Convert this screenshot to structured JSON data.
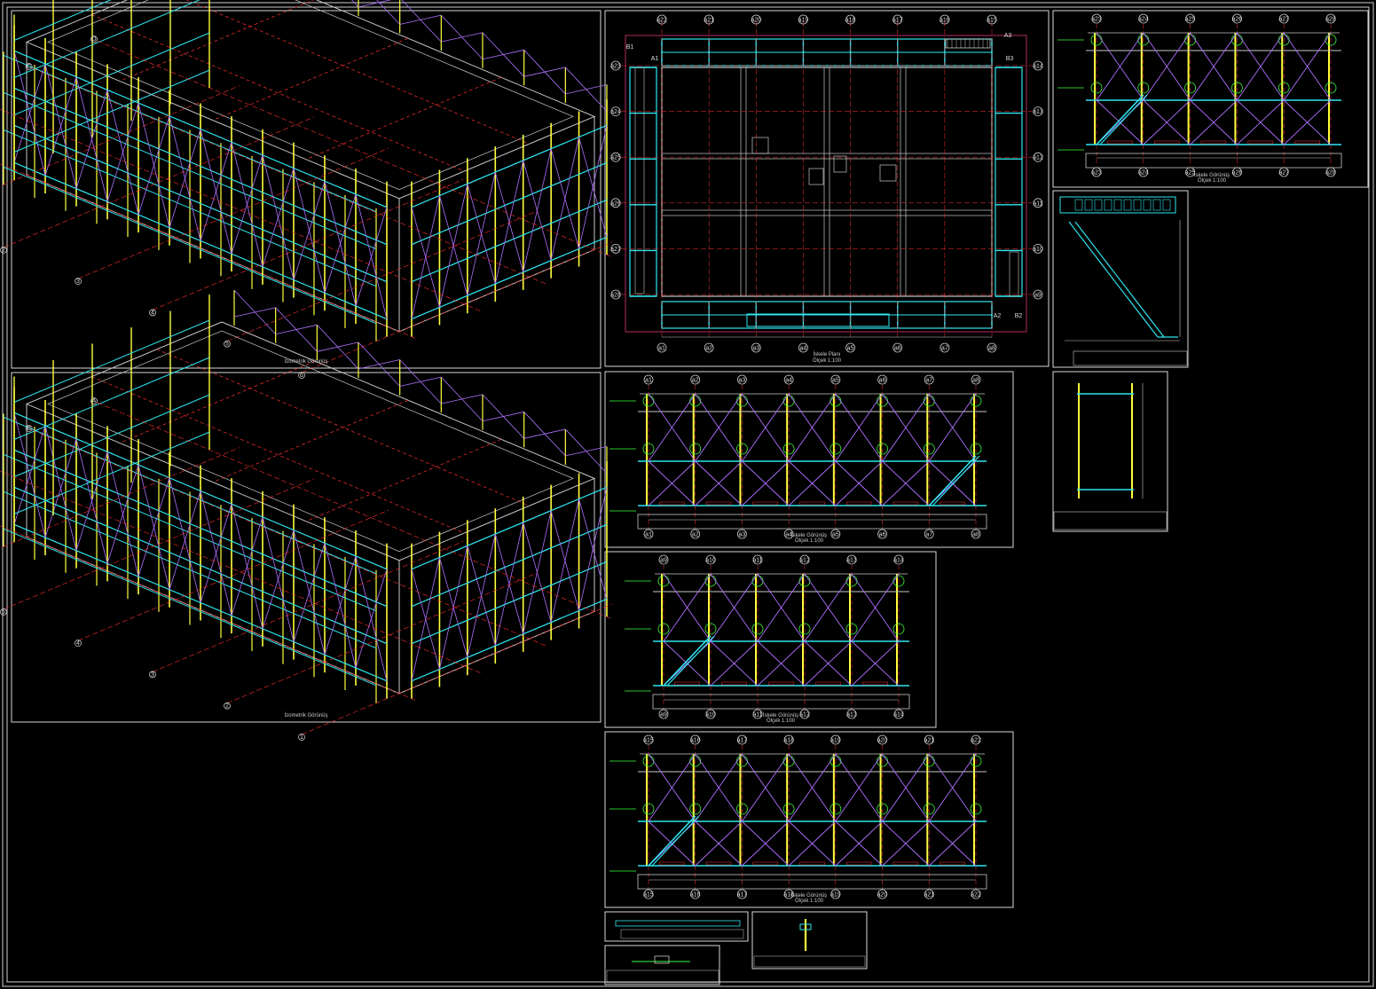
{
  "drawing": {
    "iso_caption_top": "İzometrik Görünüş",
    "iso_caption_bottom": "İzometrik Görünüş",
    "plan_caption": "İskele Planı",
    "plan_scale": "Ölçek 1:100",
    "elev_caption": "İskele Görünüş",
    "elev_scale": "Ölçek 1:100"
  },
  "grid": {
    "plan_top": [
      "a22",
      "a21",
      "a20",
      "a19",
      "a18",
      "a17",
      "a16",
      "a15"
    ],
    "plan_bottom": [
      "a1",
      "a2",
      "a3",
      "a4",
      "a5",
      "a6",
      "a7",
      "a8"
    ],
    "plan_left": [
      "a23",
      "a24",
      "a25",
      "a26",
      "a27",
      "a28"
    ],
    "plan_right": [
      "a14",
      "a13",
      "a12",
      "a11",
      "a10",
      "a9"
    ],
    "elev1": [
      "a1",
      "a2",
      "a3",
      "a4",
      "a5",
      "a6",
      "a7",
      "a8"
    ],
    "elev2": [
      "a9",
      "a10",
      "a11",
      "a12",
      "a13",
      "a14"
    ],
    "elev3": [
      "a15",
      "a16",
      "a17",
      "a18",
      "a19",
      "a20",
      "a21",
      "a22"
    ],
    "elev4": [
      "a23",
      "a24",
      "a25",
      "a26",
      "a27",
      "a28"
    ],
    "iso_top_letters": [
      "D",
      "C",
      "B",
      "A"
    ],
    "iso_top_numbers": [
      "1",
      "2",
      "3",
      "4",
      "5",
      "6"
    ],
    "iso_bottom_letters": [
      "A",
      "B",
      "C",
      "D"
    ],
    "iso_bottom_numbers": [
      "6",
      "5",
      "4",
      "3",
      "2",
      "1"
    ],
    "corner_tags": [
      "B1",
      "A1",
      "A3",
      "B3",
      "B2",
      "A2"
    ]
  },
  "colors": {
    "frame": "#d0d0d0",
    "standard": "#ffff3c",
    "ledger": "#2ee6f0",
    "brace": "#b070ff",
    "axis": "#ff3030",
    "slab": "#c8c8c8",
    "axis_bubble": "#3cff3c",
    "base": "#ff4090"
  }
}
